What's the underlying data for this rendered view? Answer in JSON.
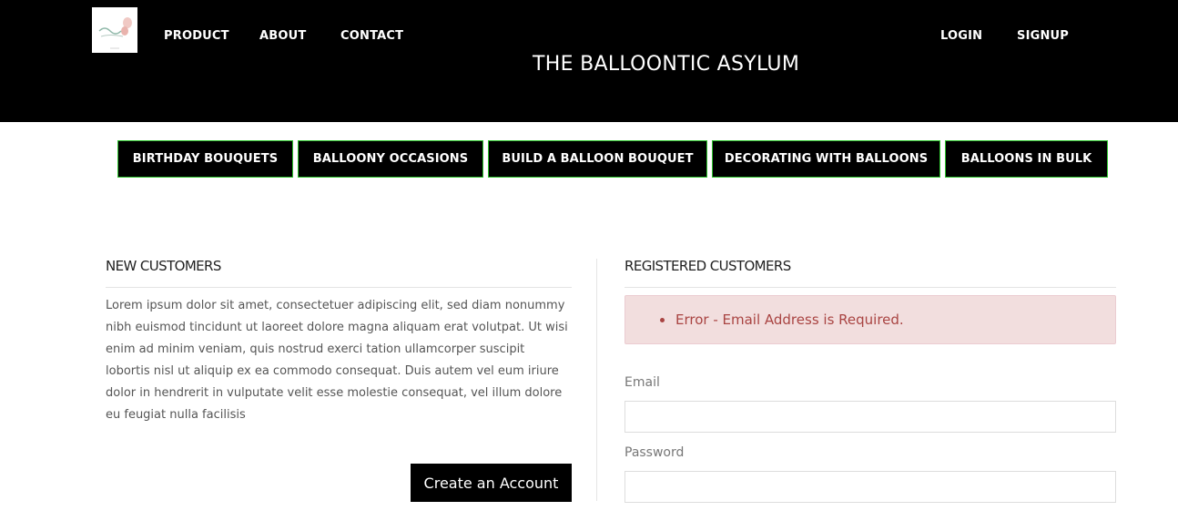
{
  "header": {
    "logo_alt": "logo",
    "nav_left": [
      "PRODUCT",
      "ABOUT",
      "CONTACT"
    ],
    "nav_right": [
      "LOGIN",
      "SIGNUP"
    ],
    "site_title": "THE BALLOONTIC ASYLUM",
    "background_color": "#000000"
  },
  "categories": [
    "BIRTHDAY BOUQUETS",
    "BALLOONY OCCASIONS",
    "BUILD A BALLOON BOUQUET",
    "DECORATING WITH BALLOONS",
    "BALLOONS IN BULK"
  ],
  "new_customers": {
    "heading": "NEW CUSTOMERS",
    "body": "Lorem ipsum dolor sit amet, consectetuer adipiscing elit, sed diam nonummy nibh euismod tincidunt ut laoreet dolore magna aliquam erat volutpat. Ut wisi enim ad minim veniam, quis nostrud exerci tation ullamcorper suscipit lobortis nisl ut aliquip ex ea commodo consequat. Duis autem vel eum iriure dolor in hendrerit in vulputate velit esse molestie consequat, vel illum dolore eu feugiat nulla facilisis",
    "button_label": "Create an Account"
  },
  "registered_customers": {
    "heading": "REGISTERED CUSTOMERS",
    "error": "Error - Email Address is Required.",
    "email_label": "Email",
    "email_value": "",
    "password_label": "Password",
    "password_value": ""
  },
  "colors": {
    "category_border": "#2ec52e",
    "error_bg": "#f2dede",
    "error_text": "#a94442"
  }
}
